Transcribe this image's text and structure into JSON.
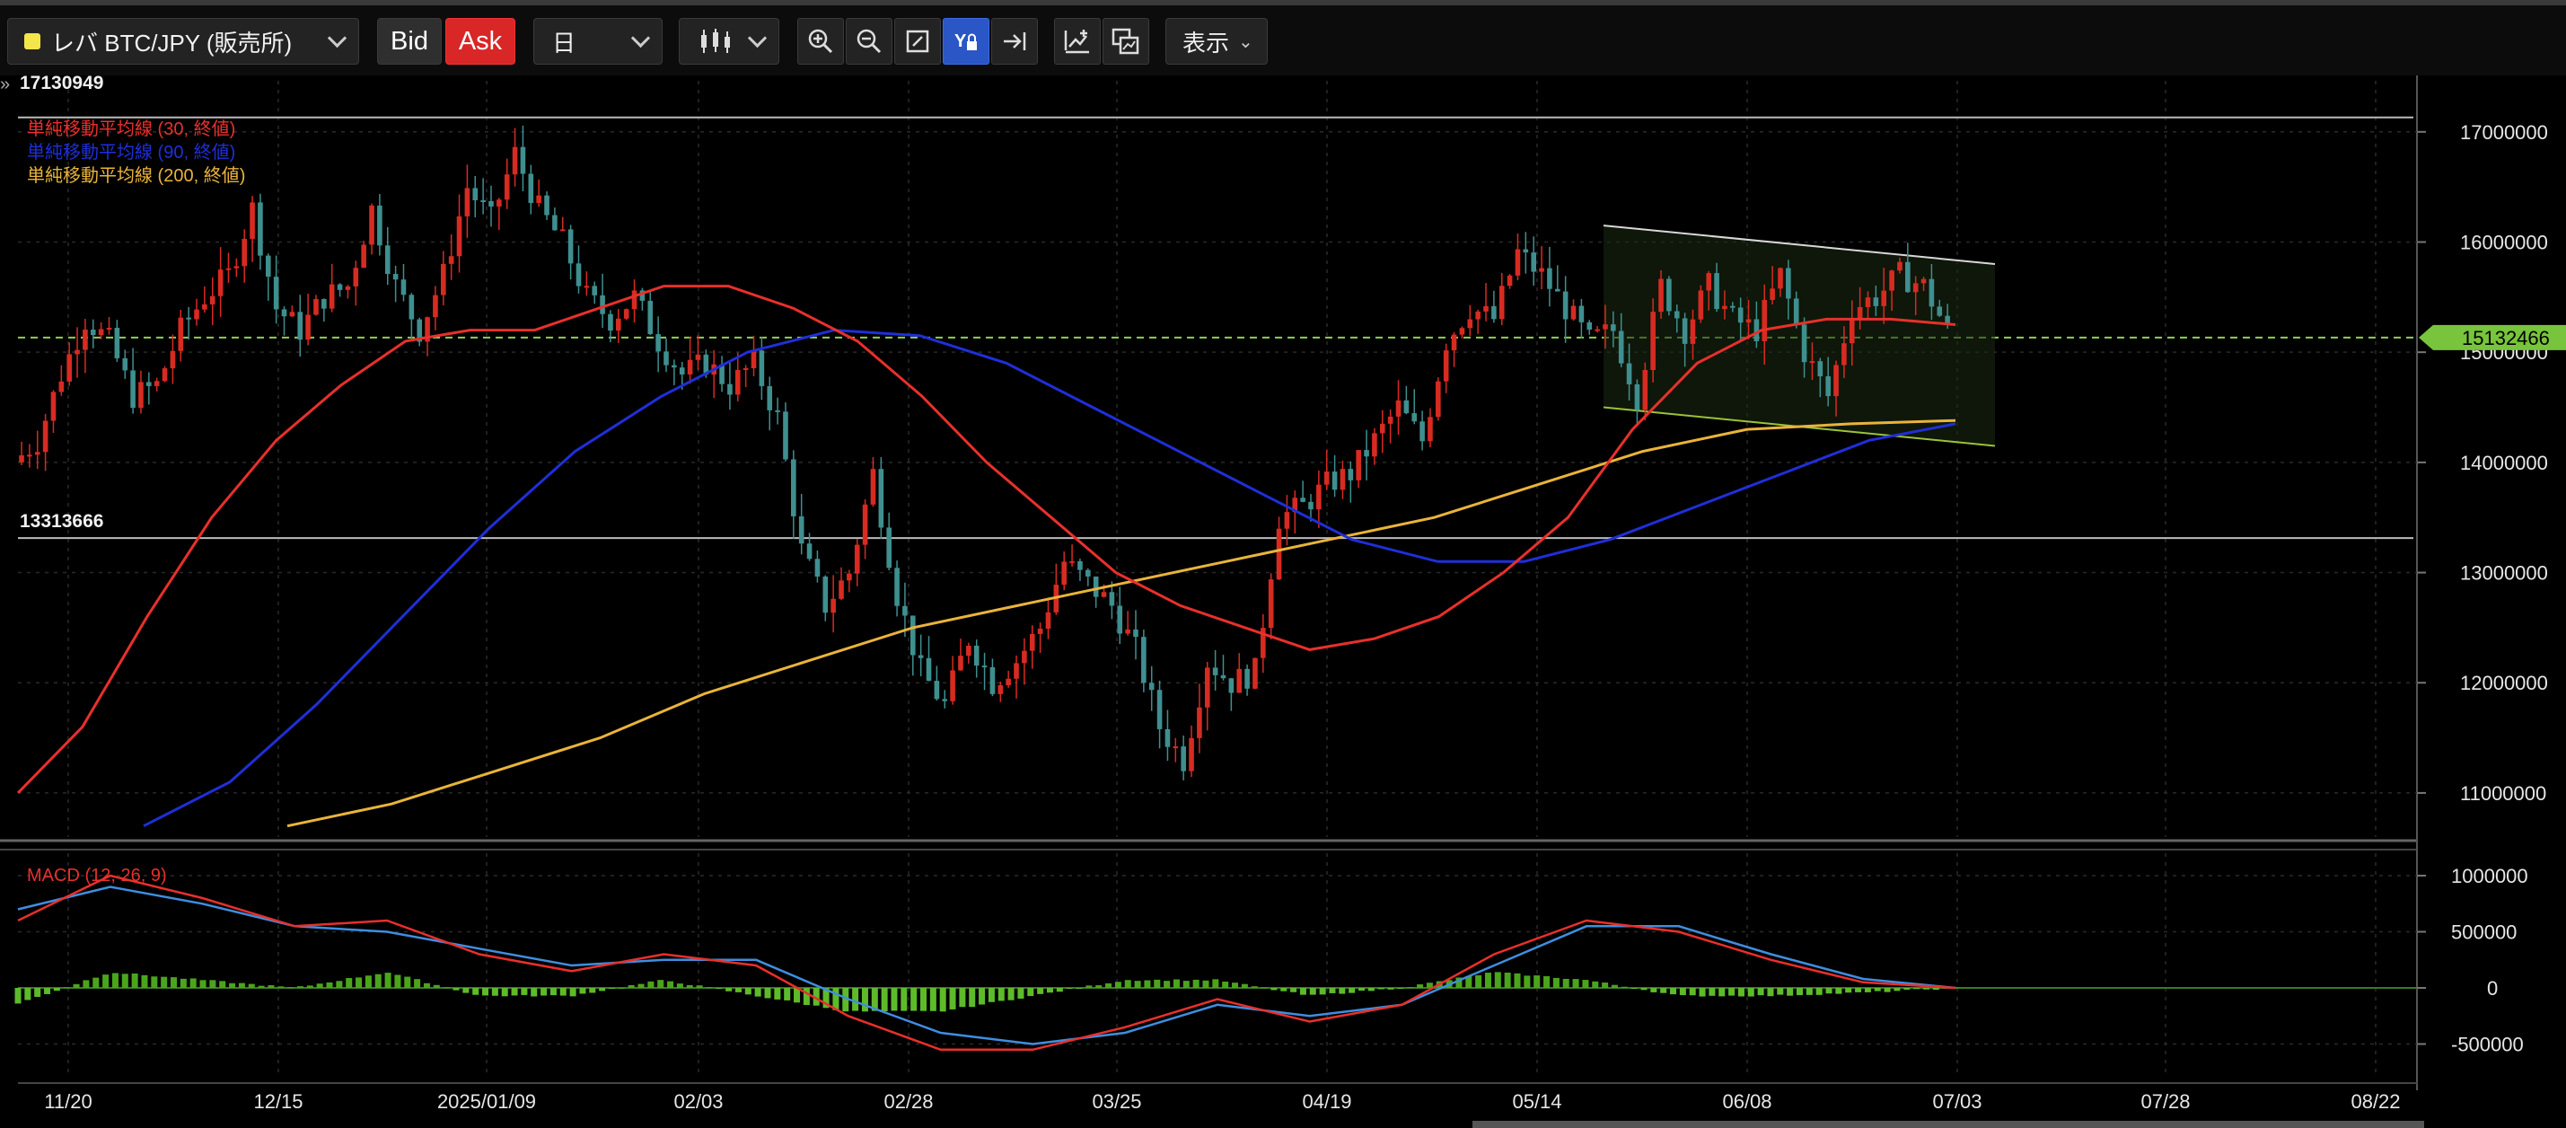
{
  "toolbar": {
    "symbol": "レバ BTC/JPY (販売所)",
    "bid_label": "Bid",
    "ask_label": "Ask",
    "timeframe": "日",
    "display_label": "表示",
    "symbol_color": "#f4e54a",
    "ask_color": "#d92626"
  },
  "indicators": {
    "sma30": "単純移動平均線 (30, 終値)",
    "sma90": "単純移動平均線 (90, 終値)",
    "sma200": "単純移動平均線 (200, 終値)",
    "macd": "MACD (12, 26, 9)"
  },
  "levels": {
    "high_label": "17130949",
    "low_label": "13313666",
    "current_label": "15132466"
  },
  "chart_data": {
    "type": "candlestick",
    "y_axis": {
      "labels": [
        "17000000",
        "16000000",
        "15000000",
        "14000000",
        "13000000",
        "12000000",
        "11000000"
      ],
      "range": [
        10600000,
        17300000
      ]
    },
    "x_axis": {
      "labels": [
        "11/20",
        "12/15",
        "2025/01/09",
        "02/03",
        "02/28",
        "03/25",
        "04/19",
        "05/14",
        "06/08",
        "07/03",
        "07/28",
        "08/22"
      ]
    },
    "macd_axis": {
      "labels": [
        "1000000",
        "500000",
        "0",
        "-500000"
      ]
    },
    "key_levels": {
      "high": 17130949,
      "low": 13313666,
      "current": 15132466
    },
    "close_path": [
      14000000,
      14200000,
      14800000,
      15300000,
      15100000,
      14600000,
      14700000,
      15200000,
      15500000,
      15700000,
      16300000,
      15400000,
      15200000,
      15500000,
      15600000,
      16300000,
      15600000,
      15200000,
      15700000,
      16500000,
      16200000,
      16800000,
      16300000,
      16000000,
      15500000,
      15300000,
      15500000,
      15100000,
      14800000,
      14900000,
      14700000,
      14900000,
      14400000,
      13200000,
      12700000,
      13000000,
      13900000,
      12800000,
      12100000,
      11800000,
      12400000,
      12000000,
      12200000,
      12500000,
      13100000,
      12900000,
      12700000,
      12300000,
      11600000,
      11300000,
      12200000,
      12000000,
      12100000,
      13500000,
      13600000,
      13800000,
      13900000,
      14200000,
      14500000,
      14200000,
      15100000,
      15400000,
      15300000,
      15900000,
      15700000,
      15400000,
      15100000,
      15200000,
      14600000,
      15600000,
      15200000,
      15600000,
      15300000,
      15200000,
      15700000,
      15000000,
      14600000,
      15400000,
      15500000,
      15700000,
      15600000,
      15200000
    ],
    "sma30": [
      11000000,
      11600000,
      12600000,
      13500000,
      14200000,
      14700000,
      15100000,
      15200000,
      15200000,
      15400000,
      15600000,
      15600000,
      15400000,
      15100000,
      14600000,
      14000000,
      13500000,
      13000000,
      12700000,
      12500000,
      12300000,
      12400000,
      12600000,
      13000000,
      13500000,
      14300000,
      14900000,
      15200000,
      15300000,
      15300000,
      15250000
    ],
    "sma90": [
      10700000,
      11100000,
      11800000,
      12600000,
      13400000,
      14100000,
      14600000,
      15000000,
      15200000,
      15150000,
      14900000,
      14500000,
      14100000,
      13700000,
      13300000,
      13100000,
      13100000,
      13300000,
      13600000,
      13900000,
      14200000,
      14350000
    ],
    "sma200": [
      10700000,
      10900000,
      11200000,
      11500000,
      11900000,
      12200000,
      12500000,
      12700000,
      12900000,
      13100000,
      13300000,
      13500000,
      13800000,
      14100000,
      14300000,
      14350000,
      14380000
    ],
    "series": [
      {
        "name": "単純移動平均線 (30, 終値)",
        "color": "#e8302c"
      },
      {
        "name": "単純移動平均線 (90, 終値)",
        "color": "#1f2fd8"
      },
      {
        "name": "単純移動平均線 (200, 終値)",
        "color": "#e9b43a"
      }
    ],
    "macd": {
      "macd_line": [
        600000,
        1000000,
        800000,
        550000,
        600000,
        300000,
        150000,
        300000,
        200000,
        -250000,
        -550000,
        -550000,
        -350000,
        -100000,
        -300000,
        -150000,
        300000,
        600000,
        500000,
        250000,
        50000,
        0
      ],
      "signal_line": [
        700000,
        900000,
        750000,
        550000,
        500000,
        350000,
        200000,
        250000,
        250000,
        -100000,
        -400000,
        -500000,
        -400000,
        -150000,
        -250000,
        -150000,
        200000,
        550000,
        550000,
        300000,
        80000,
        0
      ],
      "histogram_color_pos": "#4aa51c",
      "histogram_color_neg": "#5dbb2a"
    },
    "colors": {
      "up": "#d72b22",
      "down": "#3f8f8f",
      "background": "#000000",
      "grid": "#2a2a2a",
      "current_line": "#8fcf55"
    }
  }
}
